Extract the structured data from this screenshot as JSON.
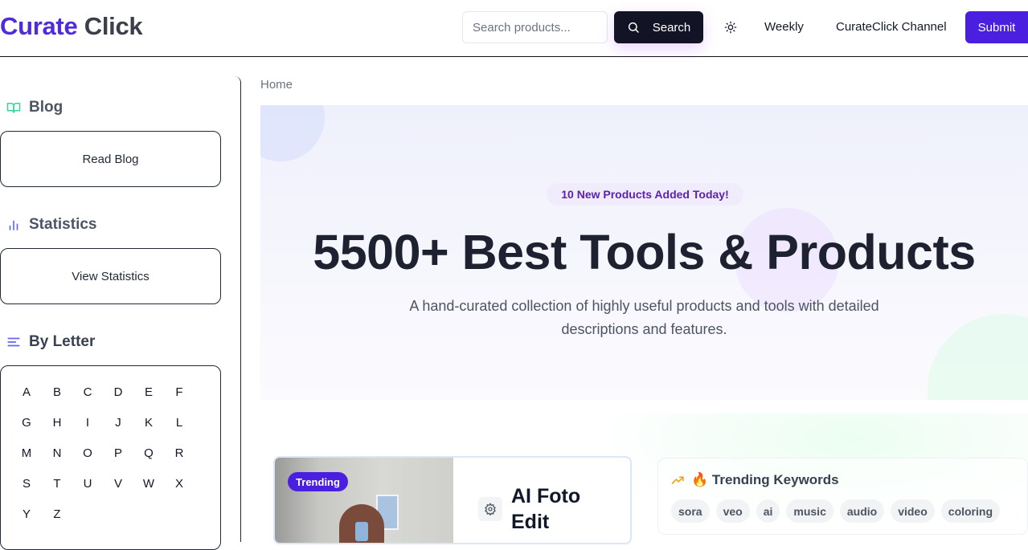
{
  "brand": {
    "part1": "Curate",
    "part2": "Click",
    "color1": "#4f2bd9",
    "color2": "#3b3f4a"
  },
  "header": {
    "search_placeholder": "Search products...",
    "search_label": "Search",
    "nav": [
      "Weekly",
      "CurateClick Channel"
    ],
    "submit_label": "Submit"
  },
  "sidebar": {
    "blog_heading": "Blog",
    "blog_button": "Read Blog",
    "stats_heading": "Statistics",
    "stats_button": "View Statistics",
    "letters_heading": "By Letter",
    "letters": [
      "A",
      "B",
      "C",
      "D",
      "E",
      "F",
      "G",
      "H",
      "I",
      "J",
      "K",
      "L",
      "M",
      "N",
      "O",
      "P",
      "Q",
      "R",
      "S",
      "T",
      "U",
      "V",
      "W",
      "X",
      "Y",
      "Z"
    ]
  },
  "main": {
    "breadcrumb": "Home",
    "hero_badge": "10 New Products Added Today!",
    "hero_title": "5500+ Best Tools & Products",
    "hero_subtitle": "A hand-curated collection of highly useful products and tools with detailed descriptions and features."
  },
  "featured": {
    "badge": "Trending",
    "title": "AI Foto Edit"
  },
  "trending": {
    "heading": "🔥 Trending Keywords",
    "keywords": [
      "sora",
      "veo",
      "ai",
      "music",
      "audio",
      "video",
      "coloring"
    ]
  },
  "colors": {
    "accent": "#4b1fe0",
    "dark": "#121426",
    "badge_text": "#5b21b6"
  }
}
